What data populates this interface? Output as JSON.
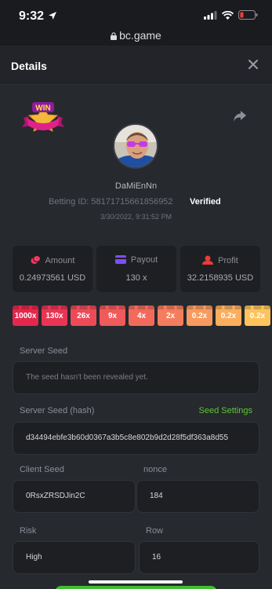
{
  "status_bar": {
    "time": "9:32",
    "url": "bc.game"
  },
  "header": {
    "title": "Details"
  },
  "bet": {
    "username": "DaMiEnNn",
    "betting_id_label": "Betting ID:",
    "betting_id": "58171715661856952",
    "verified_label": "Verified",
    "datetime": "3/30/2022, 9:31:52 PM",
    "badge_text": "WIN"
  },
  "stats": [
    {
      "label": "Amount",
      "value": "0.24973561 USD",
      "icon": "coin-icon",
      "color": "#ea3b5e"
    },
    {
      "label": "Payout",
      "value": "130 x",
      "icon": "card-icon",
      "color": "#7c4dff"
    },
    {
      "label": "Profit",
      "value": "32.2158935 USD",
      "icon": "profit-icon",
      "color": "#ea3b3b"
    }
  ],
  "multipliers": [
    {
      "label": "1000x",
      "color": "#e5274d"
    },
    {
      "label": "130x",
      "color": "#e83553"
    },
    {
      "label": "26x",
      "color": "#ec4a57"
    },
    {
      "label": "9x",
      "color": "#ef5a5a"
    },
    {
      "label": "4x",
      "color": "#f26a5c"
    },
    {
      "label": "2x",
      "color": "#f47d5e"
    },
    {
      "label": "0.2x",
      "color": "#f89a5f"
    },
    {
      "label": "0.2x",
      "color": "#fbae5e"
    },
    {
      "label": "0.2x",
      "color": "#fdc35d"
    }
  ],
  "fields": {
    "server_seed_label": "Server Seed",
    "server_seed_value": "The seed hasn't been revealed yet.",
    "server_seed_hash_label": "Server Seed (hash)",
    "seed_settings_label": "Seed Settings",
    "server_seed_hash_value": "d34494ebfe3b60d0367a3b5c8e802b9d2d28f5df363a8d55",
    "client_seed_label": "Client Seed",
    "client_seed_value": "0RsxZRSDJin2C",
    "nonce_label": "nonce",
    "nonce_value": "184",
    "risk_label": "Risk",
    "risk_value": "High",
    "row_label": "Row",
    "row_value": "16"
  },
  "colors": {
    "accent_green": "#5ec632",
    "background": "#26292e",
    "field_bg": "#1d1f23"
  }
}
